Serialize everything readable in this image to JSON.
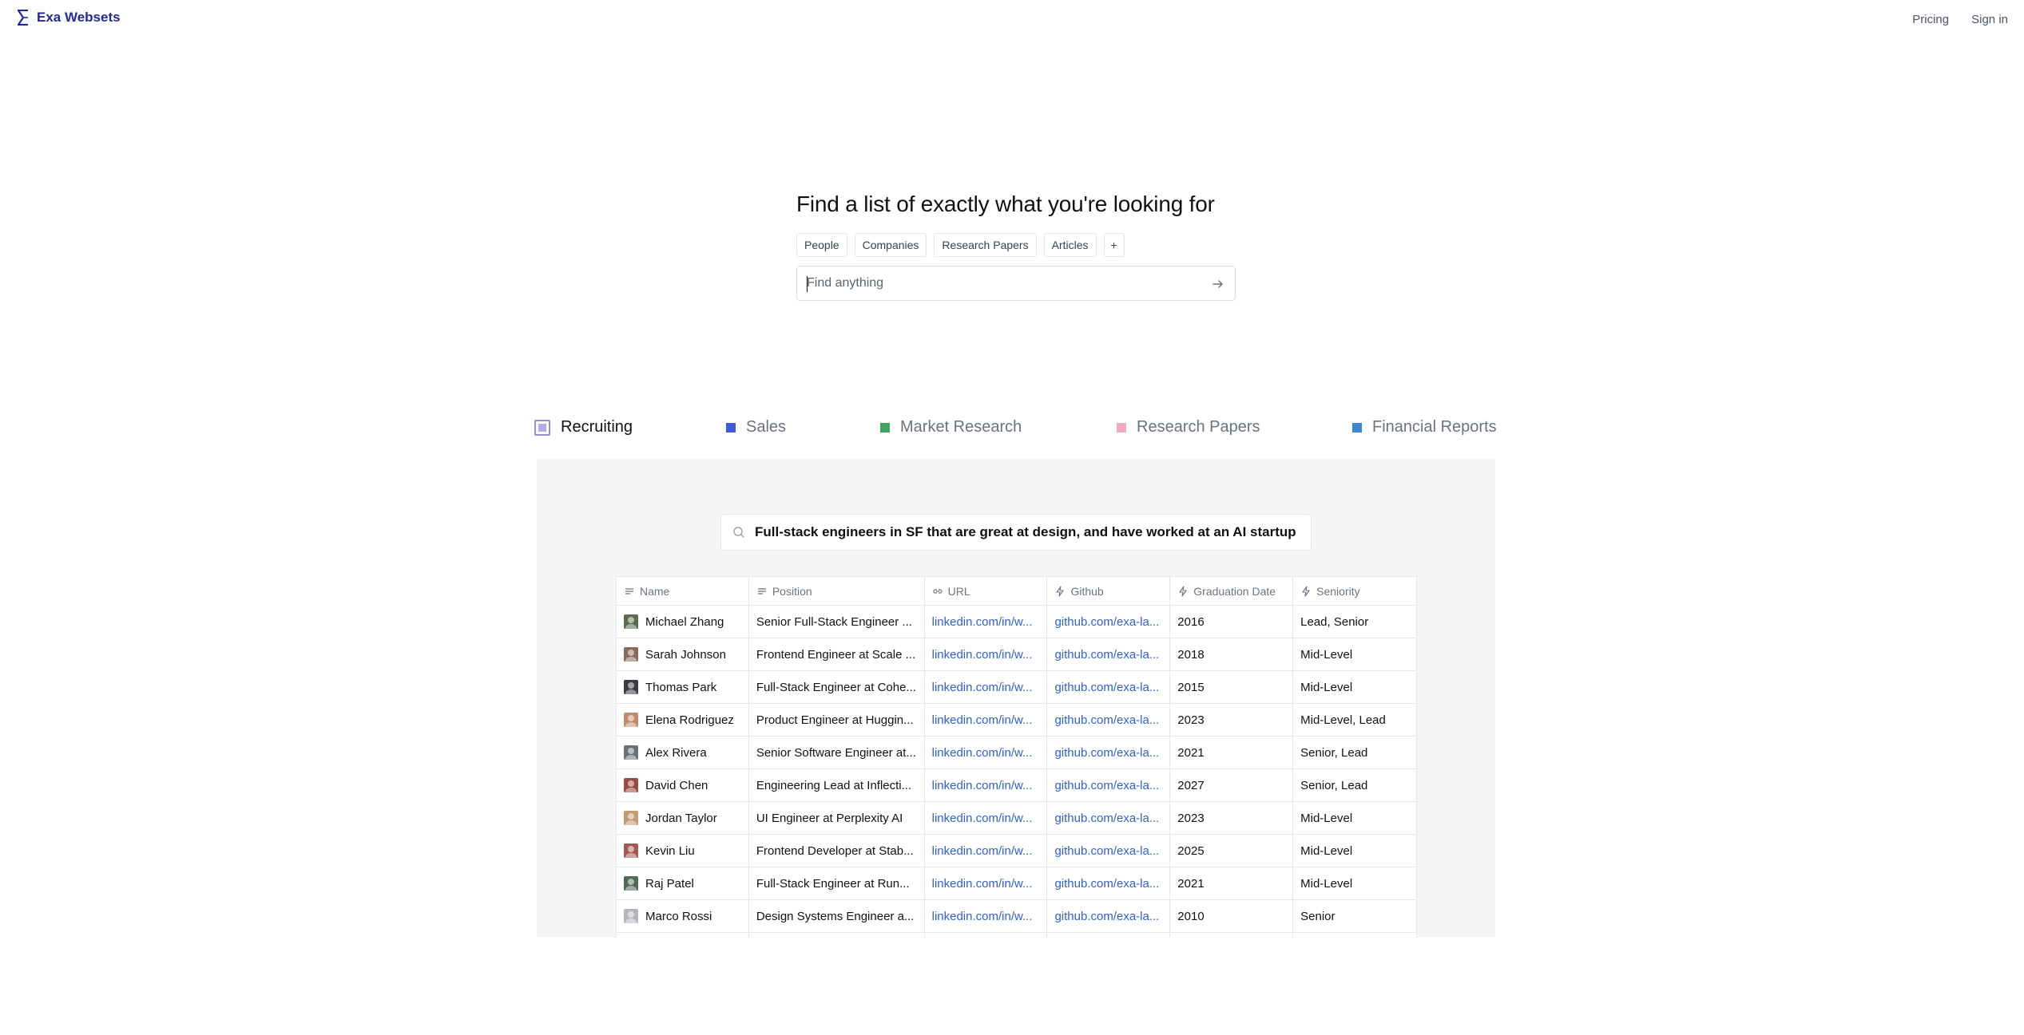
{
  "header": {
    "brand": "Exa Websets",
    "nav": [
      "Pricing",
      "Sign in"
    ]
  },
  "hero": {
    "title": "Find a list of exactly what you're looking for",
    "chips": [
      "People",
      "Companies",
      "Research Papers",
      "Articles",
      "+"
    ],
    "search_placeholder": "Find anything",
    "search_value": ""
  },
  "tabs": [
    {
      "label": "Recruiting",
      "color": "#b4a8e8",
      "active": true
    },
    {
      "label": "Sales",
      "color": "#3b5bdb",
      "active": false
    },
    {
      "label": "Market Research",
      "color": "#3fa65f",
      "active": false
    },
    {
      "label": "Research Papers",
      "color": "#f4a7c0",
      "active": false
    },
    {
      "label": "Financial Reports",
      "color": "#3f86d6",
      "active": false
    }
  ],
  "demo": {
    "query": "Full-stack engineers in SF that are great at design, and have worked at an AI startup",
    "columns": [
      {
        "label": "Name",
        "icon": "text-lines-icon"
      },
      {
        "label": "Position",
        "icon": "text-lines-icon"
      },
      {
        "label": "URL",
        "icon": "link-icon"
      },
      {
        "label": "Github",
        "icon": "bolt-icon"
      },
      {
        "label": "Graduation Date",
        "icon": "bolt-icon"
      },
      {
        "label": "Seniority",
        "icon": "bolt-icon"
      }
    ],
    "rows": [
      {
        "name": "Michael Zhang",
        "position": "Senior Full-Stack Engineer ...",
        "url": "linkedin.com/in/w...",
        "github": "github.com/exa-la...",
        "graduation": "2016",
        "seniority": "Lead, Senior",
        "avatar": "#5a6b4f"
      },
      {
        "name": "Sarah Johnson",
        "position": "Frontend Engineer at Scale ...",
        "url": "linkedin.com/in/w...",
        "github": "github.com/exa-la...",
        "graduation": "2018",
        "seniority": "Mid-Level",
        "avatar": "#8a6a5a"
      },
      {
        "name": "Thomas Park",
        "position": "Full-Stack Engineer at Cohe...",
        "url": "linkedin.com/in/w...",
        "github": "github.com/exa-la...",
        "graduation": "2015",
        "seniority": "Mid-Level",
        "avatar": "#3b3a44"
      },
      {
        "name": "Elena Rodriguez",
        "position": "Product Engineer at Huggin...",
        "url": "linkedin.com/in/w...",
        "github": "github.com/exa-la...",
        "graduation": "2023",
        "seniority": "Mid-Level, Lead",
        "avatar": "#c28a6b"
      },
      {
        "name": "Alex Rivera",
        "position": "Senior Software Engineer at...",
        "url": "linkedin.com/in/w...",
        "github": "github.com/exa-la...",
        "graduation": "2021",
        "seniority": "Senior, Lead",
        "avatar": "#6c6f78"
      },
      {
        "name": "David Chen",
        "position": "Engineering Lead at Inflecti...",
        "url": "linkedin.com/in/w...",
        "github": "github.com/exa-la...",
        "graduation": "2027",
        "seniority": "Senior, Lead",
        "avatar": "#9a4b42"
      },
      {
        "name": "Jordan Taylor",
        "position": "UI Engineer at Perplexity AI",
        "url": "linkedin.com/in/w...",
        "github": "github.com/exa-la...",
        "graduation": "2023",
        "seniority": "Mid-Level",
        "avatar": "#c49a72"
      },
      {
        "name": "Kevin Liu",
        "position": "Frontend Developer at Stab...",
        "url": "linkedin.com/in/w...",
        "github": "github.com/exa-la...",
        "graduation": "2025",
        "seniority": "Mid-Level",
        "avatar": "#a45a52"
      },
      {
        "name": "Raj Patel",
        "position": "Full-Stack Engineer at Run...",
        "url": "linkedin.com/in/w...",
        "github": "github.com/exa-la...",
        "graduation": "2021",
        "seniority": "Mid-Level",
        "avatar": "#4f6a58"
      },
      {
        "name": "Marco Rossi",
        "position": "Design Systems Engineer a...",
        "url": "linkedin.com/in/w...",
        "github": "github.com/exa-la...",
        "graduation": "2010",
        "seniority": "Senior",
        "avatar": "#b8b4bd"
      },
      {
        "name": "",
        "position": "",
        "url": "",
        "github": "",
        "graduation": "",
        "seniority": "",
        "avatar": "#ffffff"
      }
    ]
  }
}
